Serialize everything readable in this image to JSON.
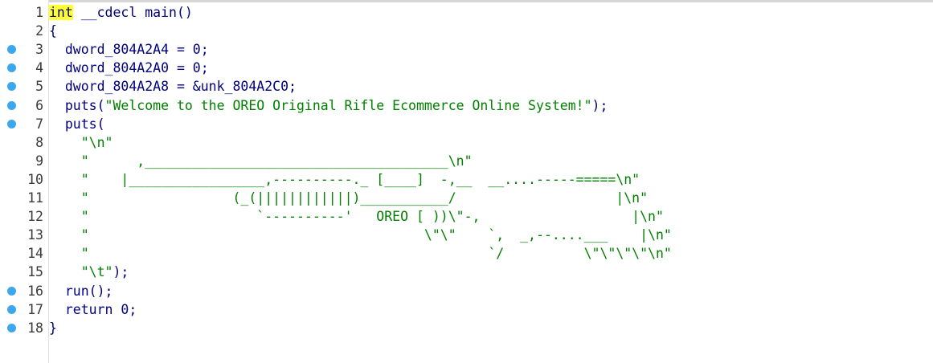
{
  "lines": [
    {
      "num": "1",
      "bp": false,
      "kw": "int",
      "text": " __cdecl main()",
      "str": ""
    },
    {
      "num": "2",
      "bp": false,
      "kw": "",
      "text": "{",
      "str": ""
    },
    {
      "num": "3",
      "bp": true,
      "kw": "",
      "text": "  dword_804A2A4 = 0;",
      "str": ""
    },
    {
      "num": "4",
      "bp": true,
      "kw": "",
      "text": "  dword_804A2A0 = 0;",
      "str": ""
    },
    {
      "num": "5",
      "bp": true,
      "kw": "",
      "text": "  dword_804A2A8 = &unk_804A2C0;",
      "str": ""
    },
    {
      "num": "6",
      "bp": true,
      "kw": "",
      "text": "  puts(",
      "str": "\"Welcome to the OREO Original Rifle Ecommerce Online System!\"",
      "tail": ");"
    },
    {
      "num": "7",
      "bp": true,
      "kw": "",
      "text": "  puts(",
      "str": ""
    },
    {
      "num": "8",
      "bp": false,
      "kw": "",
      "text": "    ",
      "str": "\"\\n\""
    },
    {
      "num": "9",
      "bp": false,
      "kw": "",
      "text": "    ",
      "str": "\"      ,______________________________________\\n\""
    },
    {
      "num": "10",
      "bp": false,
      "kw": "",
      "text": "    ",
      "str": "\"    |_________________,----------._ [____]  -,__  __....-----=====\\n\""
    },
    {
      "num": "11",
      "bp": false,
      "kw": "",
      "text": "    ",
      "str": "\"                  (_(||||||||||||)___________/                    |\\n\""
    },
    {
      "num": "12",
      "bp": false,
      "kw": "",
      "text": "    ",
      "str": "\"                     `----------'   OREO [ ))\\\"-,                   |\\n\""
    },
    {
      "num": "13",
      "bp": false,
      "kw": "",
      "text": "    ",
      "str": "\"                                          \\\"\\\"    `,  _,--....___    |\\n\""
    },
    {
      "num": "14",
      "bp": false,
      "kw": "",
      "text": "    ",
      "str": "\"                                                  `/          \\\"\\\"\\\"\\\"\\n\""
    },
    {
      "num": "15",
      "bp": false,
      "kw": "",
      "text": "    ",
      "str": "\"\\t\"",
      "tail": ");"
    },
    {
      "num": "16",
      "bp": true,
      "kw": "",
      "text": "  run();",
      "str": ""
    },
    {
      "num": "17",
      "bp": true,
      "kw": "",
      "text": "  return 0;",
      "str": ""
    },
    {
      "num": "18",
      "bp": true,
      "kw": "",
      "text": "}",
      "str": ""
    }
  ],
  "colors": {
    "keyword": "#000080",
    "string": "#008000",
    "breakpoint": "#3ba7ee",
    "highlight": "#ffff33"
  }
}
